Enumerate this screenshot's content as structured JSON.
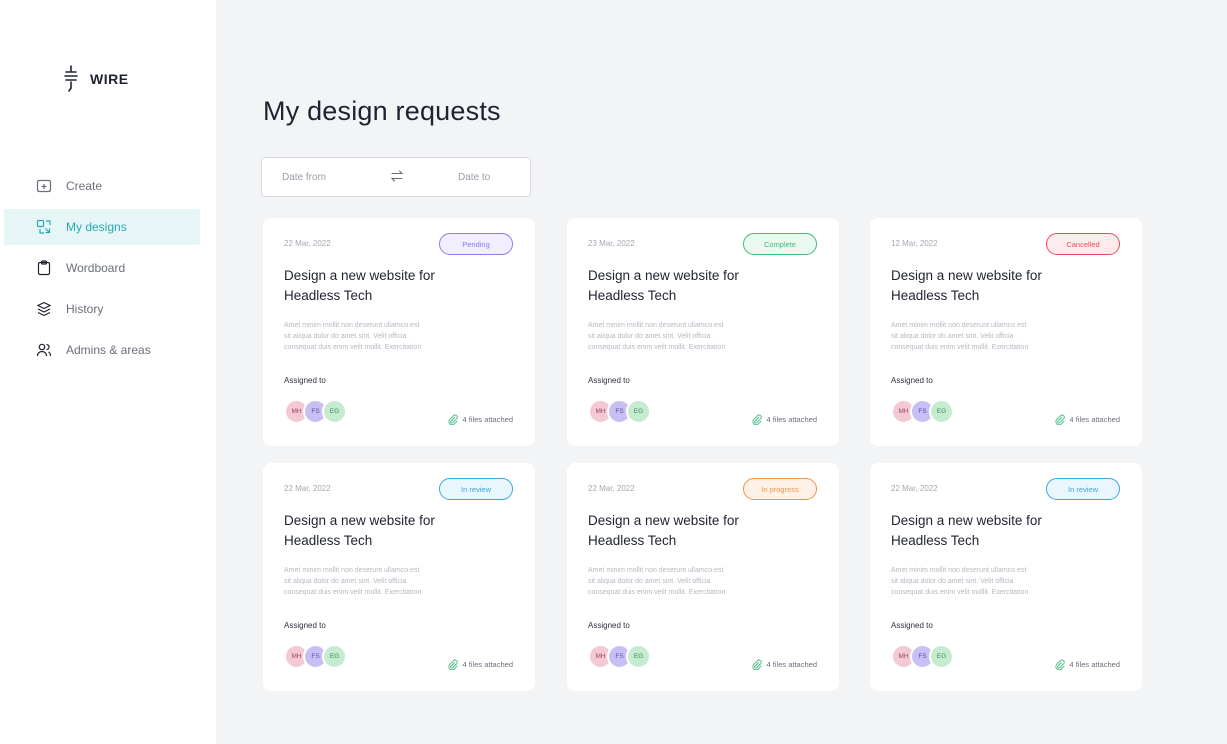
{
  "app": {
    "logo_text": "WIRE"
  },
  "sidebar": {
    "items": [
      {
        "label": "Create",
        "icon": "create-icon",
        "active": false
      },
      {
        "label": "My designs",
        "icon": "designs-icon",
        "active": true
      },
      {
        "label": "Wordboard",
        "icon": "clipboard-icon",
        "active": false
      },
      {
        "label": "History",
        "icon": "layers-icon",
        "active": false
      },
      {
        "label": "Admins & areas",
        "icon": "users-icon",
        "active": false
      }
    ]
  },
  "main": {
    "title": "My design requests",
    "filter": {
      "date_from": "Date from",
      "date_to": "Date to"
    }
  },
  "colors": {
    "accent": "#2aa8b3",
    "pending": "#8b7cf0",
    "complete": "#3dbb7a",
    "cancelled": "#e94b5b",
    "in_review": "#3aa6e0",
    "in_progress": "#f0954a"
  },
  "cards": [
    {
      "date": "22 Mar, 2022",
      "status": "Pending",
      "status_color": "#8b7cf0",
      "status_bg": "#f1eeff",
      "title_line1": "Design a new website for",
      "title_line2": "Headless Tech",
      "desc_line1": "Amet minim mollit non deserunt ullamco est",
      "desc_line2": "sit aliqua dolor do amet sint. Velit officia",
      "desc_line3": "consequat duis enim velit mollit. Exercitation",
      "assigned_label": "Assigned to",
      "avatars": [
        "MH",
        "FS",
        "EG"
      ],
      "files": "4 files attached"
    },
    {
      "date": "23 Mar, 2022",
      "status": "Complete",
      "status_color": "#3dbb7a",
      "status_bg": "#ebf9f1",
      "title_line1": "Design a new website for",
      "title_line2": "Headless Tech",
      "desc_line1": "Amet minim mollit non deserunt ullamco est",
      "desc_line2": "sit aliqua dolor do amet sint. Velit officia",
      "desc_line3": "consequat duis enim velit mollit. Exercitation",
      "assigned_label": "Assigned to",
      "avatars": [
        "MH",
        "FS",
        "EG"
      ],
      "files": "4 files attached"
    },
    {
      "date": "12 Mar, 2022",
      "status": "Cancelled",
      "status_color": "#e94b5b",
      "status_bg": "#fdecee",
      "title_line1": "Design a new website for",
      "title_line2": "Headless Tech",
      "desc_line1": "Amet minim mollit non deserunt ullamco est",
      "desc_line2": "sit aliqua dolor do amet sint. Velit officia",
      "desc_line3": "consequat duis enim velit mollit. Exercitation",
      "assigned_label": "Assigned to",
      "avatars": [
        "MH",
        "FS",
        "EG"
      ],
      "files": "4 files attached"
    },
    {
      "date": "22 Mar, 2022",
      "status": "In review",
      "status_color": "#3aa6e0",
      "status_bg": "#eaf6fd",
      "title_line1": "Design a new website for",
      "title_line2": "Headless Tech",
      "desc_line1": "Amet minim mollit non deserunt ullamco est",
      "desc_line2": "sit aliqua dolor do amet sint. Velit officia",
      "desc_line3": "consequat duis enim velit mollit. Exercitation",
      "assigned_label": "Assigned to",
      "avatars": [
        "MH",
        "FS",
        "EG"
      ],
      "files": "4 files attached"
    },
    {
      "date": "22 Mar, 2022",
      "status": "In progress",
      "status_color": "#f0954a",
      "status_bg": "#fef2e7",
      "title_line1": "Design a new website for",
      "title_line2": "Headless Tech",
      "desc_line1": "Amet minim mollit non deserunt ullamco est",
      "desc_line2": "sit aliqua dolor do amet sint. Velit officia",
      "desc_line3": "consequat duis enim velit mollit. Exercitation",
      "assigned_label": "Assigned to",
      "avatars": [
        "MH",
        "FS",
        "EG"
      ],
      "files": "4 files attached"
    },
    {
      "date": "22 Mar, 2022",
      "status": "In review",
      "status_color": "#3aa6e0",
      "status_bg": "#eaf6fd",
      "title_line1": "Design a new website for",
      "title_line2": "Headless Tech",
      "desc_line1": "Amet minim mollit non deserunt ullamco est",
      "desc_line2": "sit aliqua dolor do amet sint. Velit officia",
      "desc_line3": "consequat duis enim velit mollit. Exercitation",
      "assigned_label": "Assigned to",
      "avatars": [
        "MH",
        "FS",
        "EG"
      ],
      "files": "4 files attached"
    }
  ]
}
